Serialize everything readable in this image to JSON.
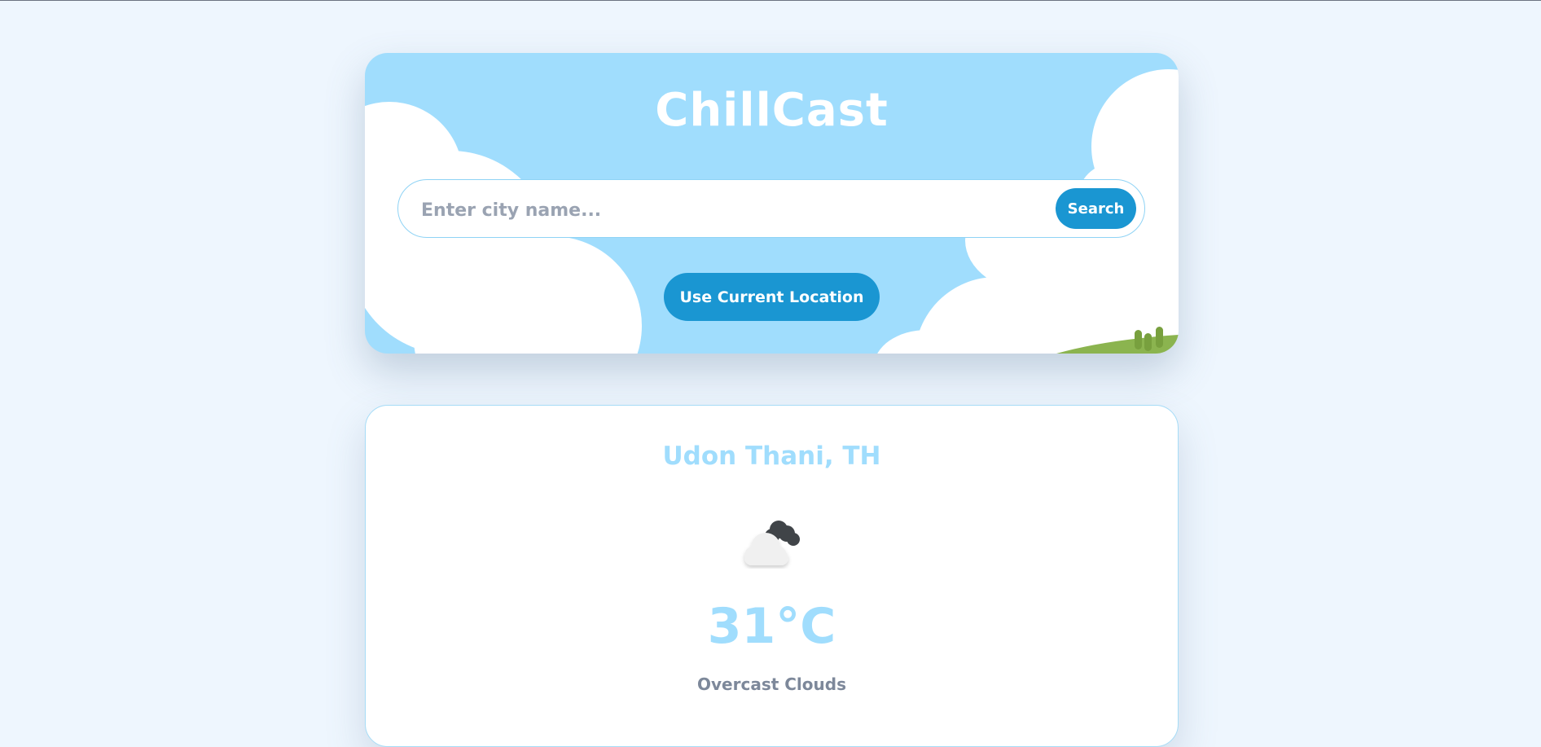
{
  "app": {
    "title": "ChillCast"
  },
  "search": {
    "placeholder": "Enter city name...",
    "value": "",
    "button_label": "Search"
  },
  "location_button_label": "Use Current Location",
  "weather": {
    "city": "Udon Thani, TH",
    "temperature": "31°C",
    "description": "Overcast Clouds",
    "icon": "overcast-clouds-icon"
  },
  "colors": {
    "page_background": "#eef6fe",
    "sky": "#a0ddfd",
    "accent_button": "#1a96d2",
    "text_muted": "#7d889a",
    "grass": "#8bb44f"
  }
}
